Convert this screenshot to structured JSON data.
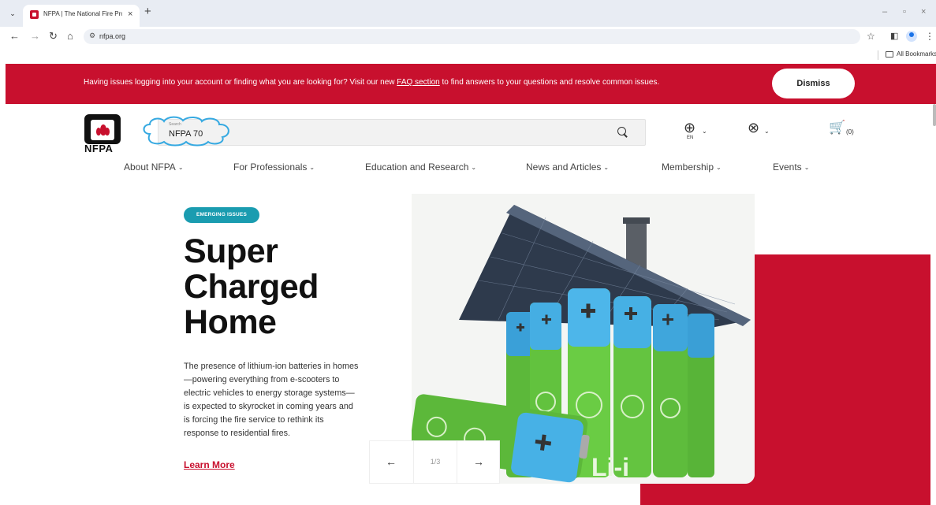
{
  "browser": {
    "tab_title": "NFPA | The National Fire Protec",
    "tab_close": "×",
    "new_tab": "+",
    "tab_dropdown": "⌄",
    "url": "nfpa.org",
    "bookmarks_label": "All Bookmarks",
    "window_controls": [
      "–",
      "▫",
      "×"
    ]
  },
  "alert": {
    "text_before": "Having issues logging into your account or finding what you are looking for? Visit our new ",
    "link": "FAQ section",
    "text_after": " to find answers to your questions and resolve common issues.",
    "dismiss": "Dismiss"
  },
  "header": {
    "logo_text": "NFPA",
    "search_label": "Search",
    "search_value": "NFPA 70",
    "language": "EN",
    "cart_count": "(0)"
  },
  "nav": {
    "items": [
      "About NFPA",
      "For Professionals",
      "Education and Research",
      "News and Articles",
      "Membership",
      "Events"
    ]
  },
  "hero": {
    "badge": "EMERGING ISSUES",
    "title_lines": [
      "Super",
      "Charged",
      "Home"
    ],
    "body": "The presence of lithium-ion batteries in homes—powering everything from e-scooters to electric vehicles to energy storage systems—is expected to skyrocket in coming years and is forcing the fire service to rethink its response to residential fires.",
    "cta": "Learn More",
    "battery_label": "Li-i",
    "pager": "1/3",
    "prev": "←",
    "next": "→"
  },
  "colors": {
    "brand_red": "#c8102e",
    "badge_teal": "#1a9cb0",
    "annotation_blue": "#36a9e1"
  }
}
